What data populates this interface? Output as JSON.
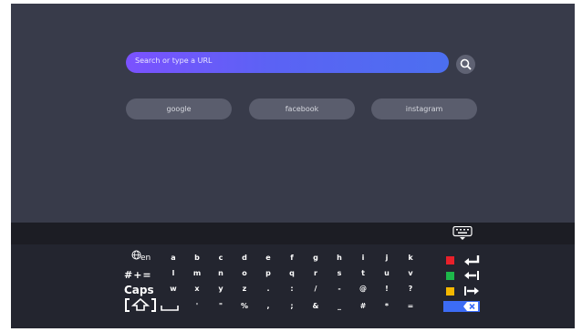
{
  "search": {
    "placeholder": "Search or type a URL"
  },
  "shortcuts": [
    "google",
    "facebook",
    "instagram"
  ],
  "keyboard": {
    "lang_label": "en",
    "symbols_label": "#+=",
    "caps_label": "Caps",
    "rows": [
      [
        "a",
        "b",
        "c",
        "d",
        "e",
        "f",
        "g",
        "h",
        "i",
        "j",
        "k"
      ],
      [
        "l",
        "m",
        "n",
        "o",
        "p",
        "q",
        "r",
        "s",
        "t",
        "u",
        "v"
      ],
      [
        "w",
        "x",
        "y",
        "z",
        ".",
        ":",
        "/",
        "-",
        "@",
        "!",
        "?"
      ],
      [
        "'",
        "\"",
        "%",
        ",",
        ";",
        "&",
        "_",
        "#",
        "*",
        "="
      ]
    ],
    "color_keys": [
      "#e8202a",
      "#1db84a",
      "#f5b800",
      "#3c6cf5"
    ]
  },
  "colors": {
    "background": "#383b4a",
    "keyboard": "#23252f",
    "accent": "#6a5cff"
  }
}
